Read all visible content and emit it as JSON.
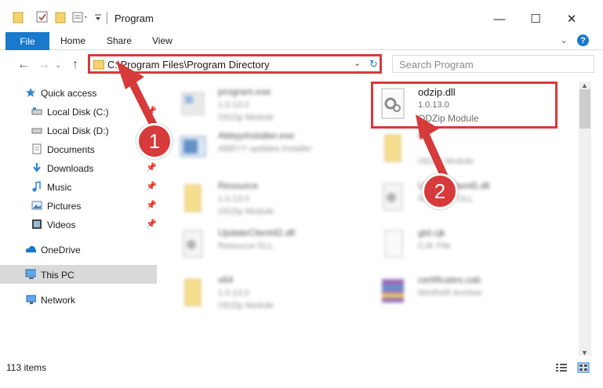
{
  "window": {
    "title": "Program",
    "minimize": "—",
    "maximize": "☐",
    "close": "✕"
  },
  "ribbon": {
    "file_tab": "File",
    "tabs": [
      "Home",
      "Share",
      "View"
    ],
    "help": "?"
  },
  "address": {
    "path": "C:\\Program Files\\Program Directory",
    "search_placeholder": "Search Program"
  },
  "sidebar": {
    "items": [
      {
        "label": "Quick access",
        "icon": "star-icon",
        "pinned": false
      },
      {
        "label": "Local Disk (C:)",
        "icon": "drive-icon",
        "pinned": true
      },
      {
        "label": "Local Disk (D:)",
        "icon": "drive-icon",
        "pinned": false
      },
      {
        "label": "Documents",
        "icon": "documents-icon",
        "pinned": true
      },
      {
        "label": "Downloads",
        "icon": "download-icon",
        "pinned": true
      },
      {
        "label": "Music",
        "icon": "music-icon",
        "pinned": true
      },
      {
        "label": "Pictures",
        "icon": "pictures-icon",
        "pinned": true
      },
      {
        "label": "Videos",
        "icon": "videos-icon",
        "pinned": true
      },
      {
        "label": "OneDrive",
        "icon": "cloud-icon",
        "pinned": false
      },
      {
        "label": "This PC",
        "icon": "computer-icon",
        "pinned": false,
        "selected": true
      },
      {
        "label": "Network",
        "icon": "network-icon",
        "pinned": false
      }
    ]
  },
  "files": [
    {
      "name": "program.exe",
      "version": "1.0.13.0",
      "desc": "ODZip Module",
      "icon": "exe-icon"
    },
    {
      "name": "odzip.dll",
      "version": "1.0.13.0",
      "desc": "ODZip Module",
      "icon": "dll-gear-icon"
    },
    {
      "name": "AbbyyInstaller.exe",
      "version": "",
      "desc": "ABBYY updates installer",
      "icon": "installer-icon"
    },
    {
      "name": "en",
      "version": "",
      "desc": "ODZip Module",
      "icon": "folder-icon"
    },
    {
      "name": "Resource",
      "version": "1.0.13.0",
      "desc": "ODZip Module",
      "icon": "folder-icon"
    },
    {
      "name": "UpdateClient5.dll",
      "version": "",
      "desc": "Resource DLL",
      "icon": "dll-gear-icon"
    },
    {
      "name": "UpdateClient42.dll",
      "version": "",
      "desc": "Resource DLL",
      "icon": "dll-gear-icon"
    },
    {
      "name": "gtd.cjk",
      "version": "",
      "desc": "CJK File",
      "icon": "file-icon"
    },
    {
      "name": "x64",
      "version": "1.0.13.0",
      "desc": "ODZip Module",
      "icon": "folder-icon"
    },
    {
      "name": "certificates.cab",
      "version": "",
      "desc": "WinRAR Archive",
      "icon": "winrar-icon"
    }
  ],
  "status": {
    "item_count": "113 items"
  },
  "callouts": [
    "1",
    "2"
  ],
  "colors": {
    "accent": "#1979ca",
    "highlight": "#d63a3a"
  }
}
